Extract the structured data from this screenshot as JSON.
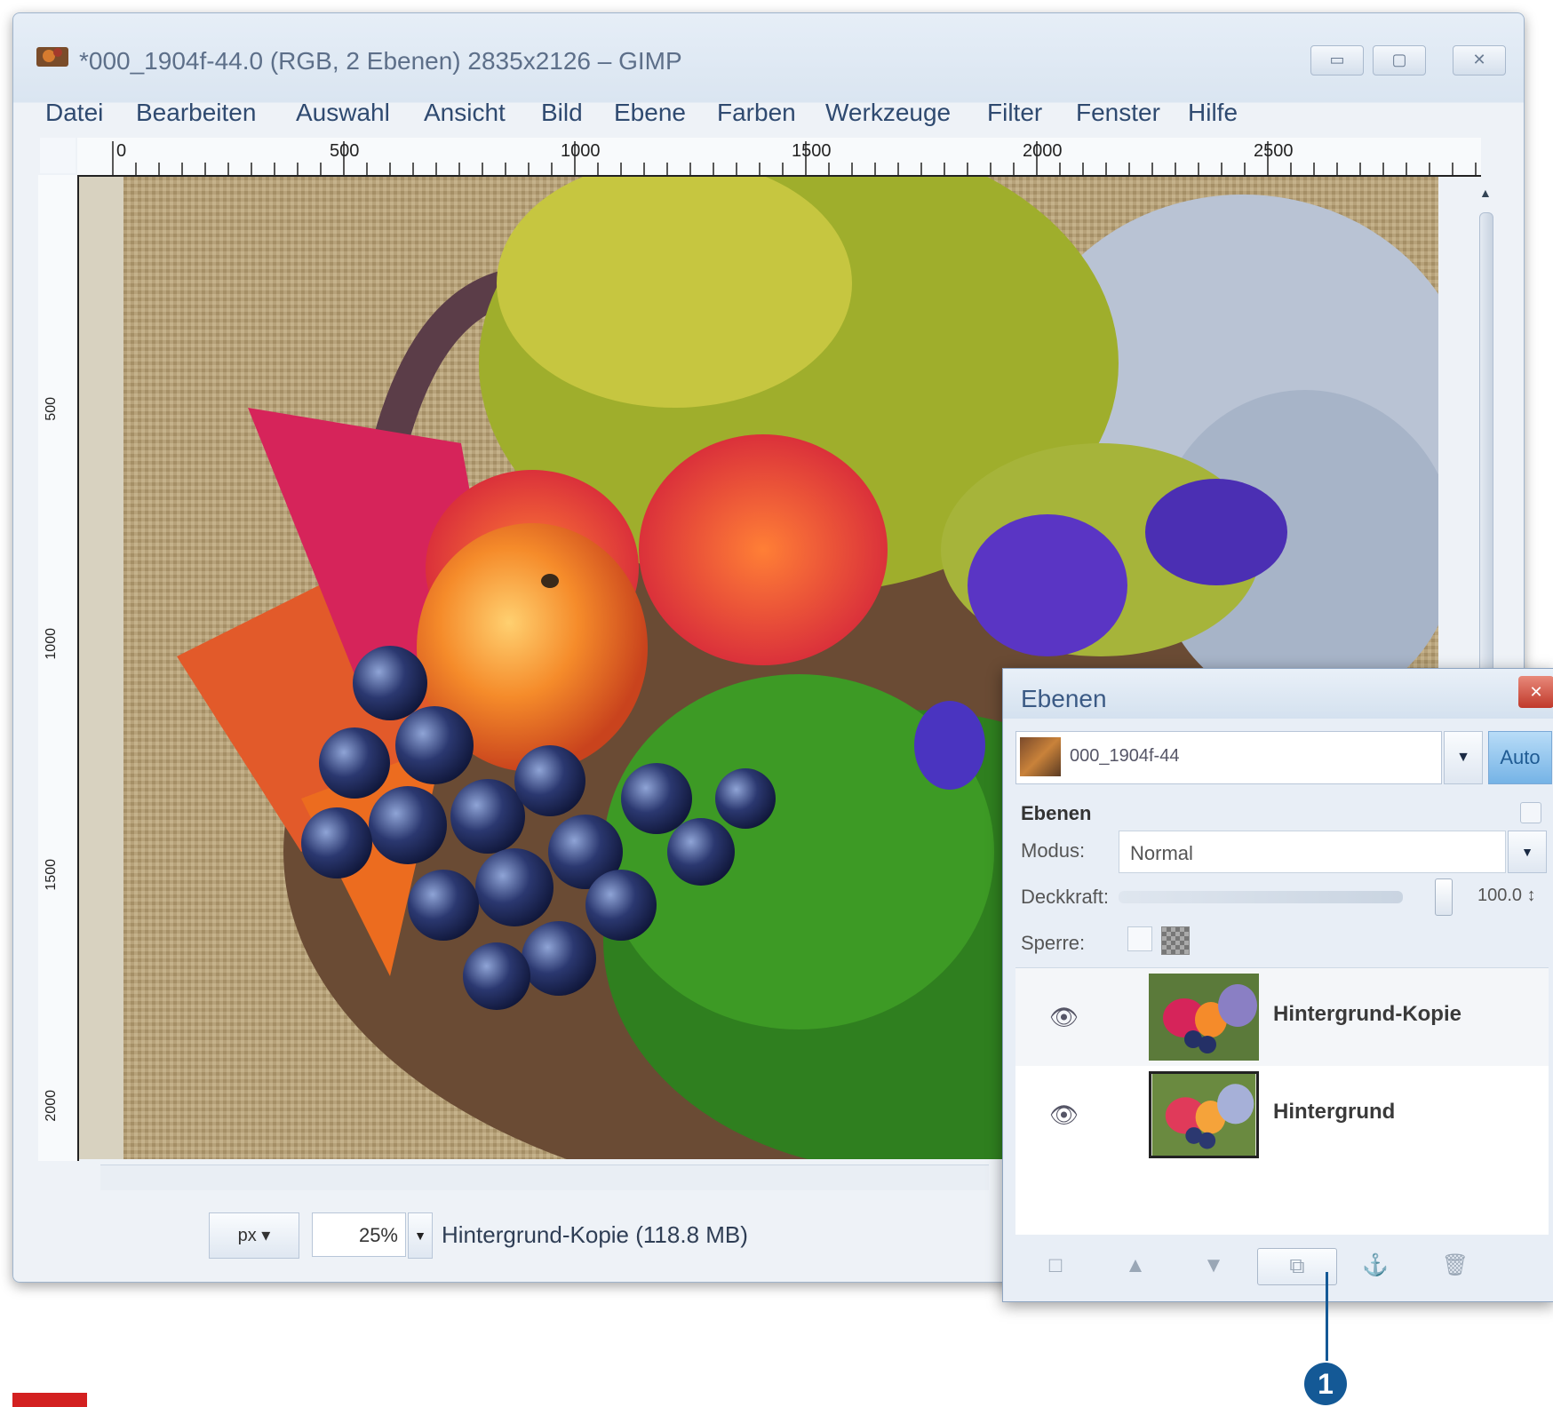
{
  "window": {
    "title": "*000_1904f-44.0 (RGB, 2 Ebenen) 2835x2126 – GIMP",
    "controls": [
      "▭",
      "▢",
      "✕"
    ]
  },
  "menu": [
    "Datei",
    "Bearbeiten",
    "Auswahl",
    "Ansicht",
    "Bild",
    "Ebene",
    "Farben",
    "Werkzeuge",
    "Filter",
    "Fenster",
    "Hilfe"
  ],
  "ruler": {
    "h_labels": [
      "0",
      "500",
      "1000",
      "1500",
      "2000",
      "2500"
    ],
    "v_labels": [
      "500",
      "1000",
      "1500",
      "2000"
    ]
  },
  "canvas": {
    "content": "Herbstliches Gesteck mit Apfel, Trauben, Rosen und Heide"
  },
  "statusbar": {
    "unit": "px",
    "zoom": "25%",
    "status": "Hintergrund-Kopie (118.8 MB)"
  },
  "layers_dialog": {
    "title": "Ebenen",
    "image_selector": "000_1904f-44",
    "auto_button": "Auto",
    "section": "Ebenen",
    "mode_label": "Modus:",
    "mode_value": "Normal",
    "opacity_label": "Deckkraft:",
    "opacity_value": "100.0",
    "opacity": 1.0,
    "lock_label": "Sperre:",
    "layers": [
      {
        "name": "Hintergrund-Kopie",
        "visible": true,
        "selected": false
      },
      {
        "name": "Hintergrund",
        "visible": true,
        "selected": true
      }
    ],
    "footer_buttons": [
      "new-layer-icon",
      "raise-layer-icon",
      "lower-layer-icon",
      "duplicate-layer-icon",
      "anchor-layer-icon",
      "delete-layer-icon"
    ]
  },
  "callout": {
    "number": "1"
  },
  "colors": {
    "callout": "#145996",
    "marker": "#d32020"
  }
}
